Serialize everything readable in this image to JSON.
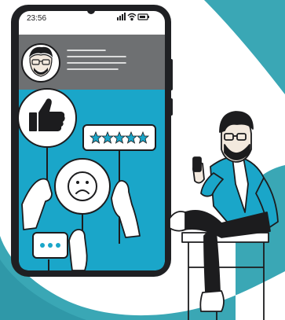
{
  "status_bar": {
    "time": "23:56",
    "icons": [
      "signal-icon",
      "wifi-icon",
      "battery-icon"
    ]
  },
  "profile_card": {
    "avatar": "man-with-glasses-avatar",
    "text_lines": 4
  },
  "feedback_signs": [
    {
      "icon": "thumbs-up-icon"
    },
    {
      "icon": "five-star-rating",
      "stars": 5
    },
    {
      "icon": "sad-face-icon"
    },
    {
      "icon": "chat-ellipsis-icon"
    }
  ],
  "colors": {
    "accent": "#1aa6c9",
    "background_blob": "#3aa7b5",
    "phone_frame": "#1f2023",
    "header_gray": "#6e7072",
    "outline": "#1c1c1e"
  },
  "illustration": {
    "subject": "man-sitting-on-chair-with-phone"
  }
}
